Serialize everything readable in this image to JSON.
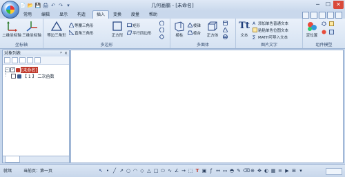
{
  "window": {
    "title": "几何画霸 - [未命名]",
    "controls": [
      "─",
      "☐",
      "✕"
    ]
  },
  "quick_access": [
    "📄",
    "📂",
    "💾",
    "🖨",
    "↶",
    "↷",
    "▾"
  ],
  "tabs": [
    {
      "label": "常用",
      "active": false
    },
    {
      "label": "编辑",
      "active": false
    },
    {
      "label": "显示",
      "active": false
    },
    {
      "label": "构造",
      "active": false
    },
    {
      "label": "插入",
      "active": true
    },
    {
      "label": "变换",
      "active": false
    },
    {
      "label": "度量",
      "active": false
    },
    {
      "label": "帮助",
      "active": false
    }
  ],
  "ribbon": {
    "groups": {
      "coords": "坐标轴",
      "polygon": "多边形",
      "polyhedron": "多面体",
      "picture_text": "图片文字",
      "component": "组件模型"
    },
    "buttons": {
      "coord2d": "二维坐标轴",
      "coord3d": "三维坐标轴",
      "equilateral": "等边三角形",
      "isosceles": "等腰三角形",
      "right_tri": "直角三角形",
      "square": "正方形",
      "rectangle": "矩形",
      "parallelogram": "平行四边形",
      "prism": "棱柱",
      "pyramid": "棱锥",
      "frustum": "棱台",
      "cube": "正方体",
      "text": "文本",
      "add_text": "添加单色普通文本",
      "paste_mono": "粘贴单色位图文本",
      "math_import": "MATH可导入文本",
      "position": "定位置"
    }
  },
  "left_pane": {
    "title": "对象列表",
    "pin": "ᵖ",
    "close": "×",
    "tree": [
      {
        "label": "[未命名]",
        "level": 0
      },
      {
        "label": "【 1 】 二次函数",
        "level": 1
      }
    ]
  },
  "status": {
    "ready": "就绪",
    "page": "当前页：第一页"
  }
}
